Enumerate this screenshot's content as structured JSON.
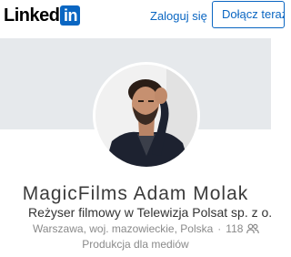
{
  "header": {
    "logo_text": "Linked",
    "logo_box_text": "in",
    "signin_label": "Zaloguj się",
    "join_label": "Dołącz teraz"
  },
  "profile": {
    "name": "MagicFilms Adam Molak",
    "headline": "Reżyser filmowy w Telewizja Polsat sp. z o.o.",
    "location": "Warszawa, woj. mazowieckie, Polska",
    "separator": "·",
    "connections": "118",
    "industry": "Produkcja dla mediów"
  },
  "colors": {
    "brand": "#0a66c2",
    "cover": "#e6e9ec",
    "muted_text": "#8a8a8a"
  },
  "icons": {
    "connections": "people-icon"
  }
}
